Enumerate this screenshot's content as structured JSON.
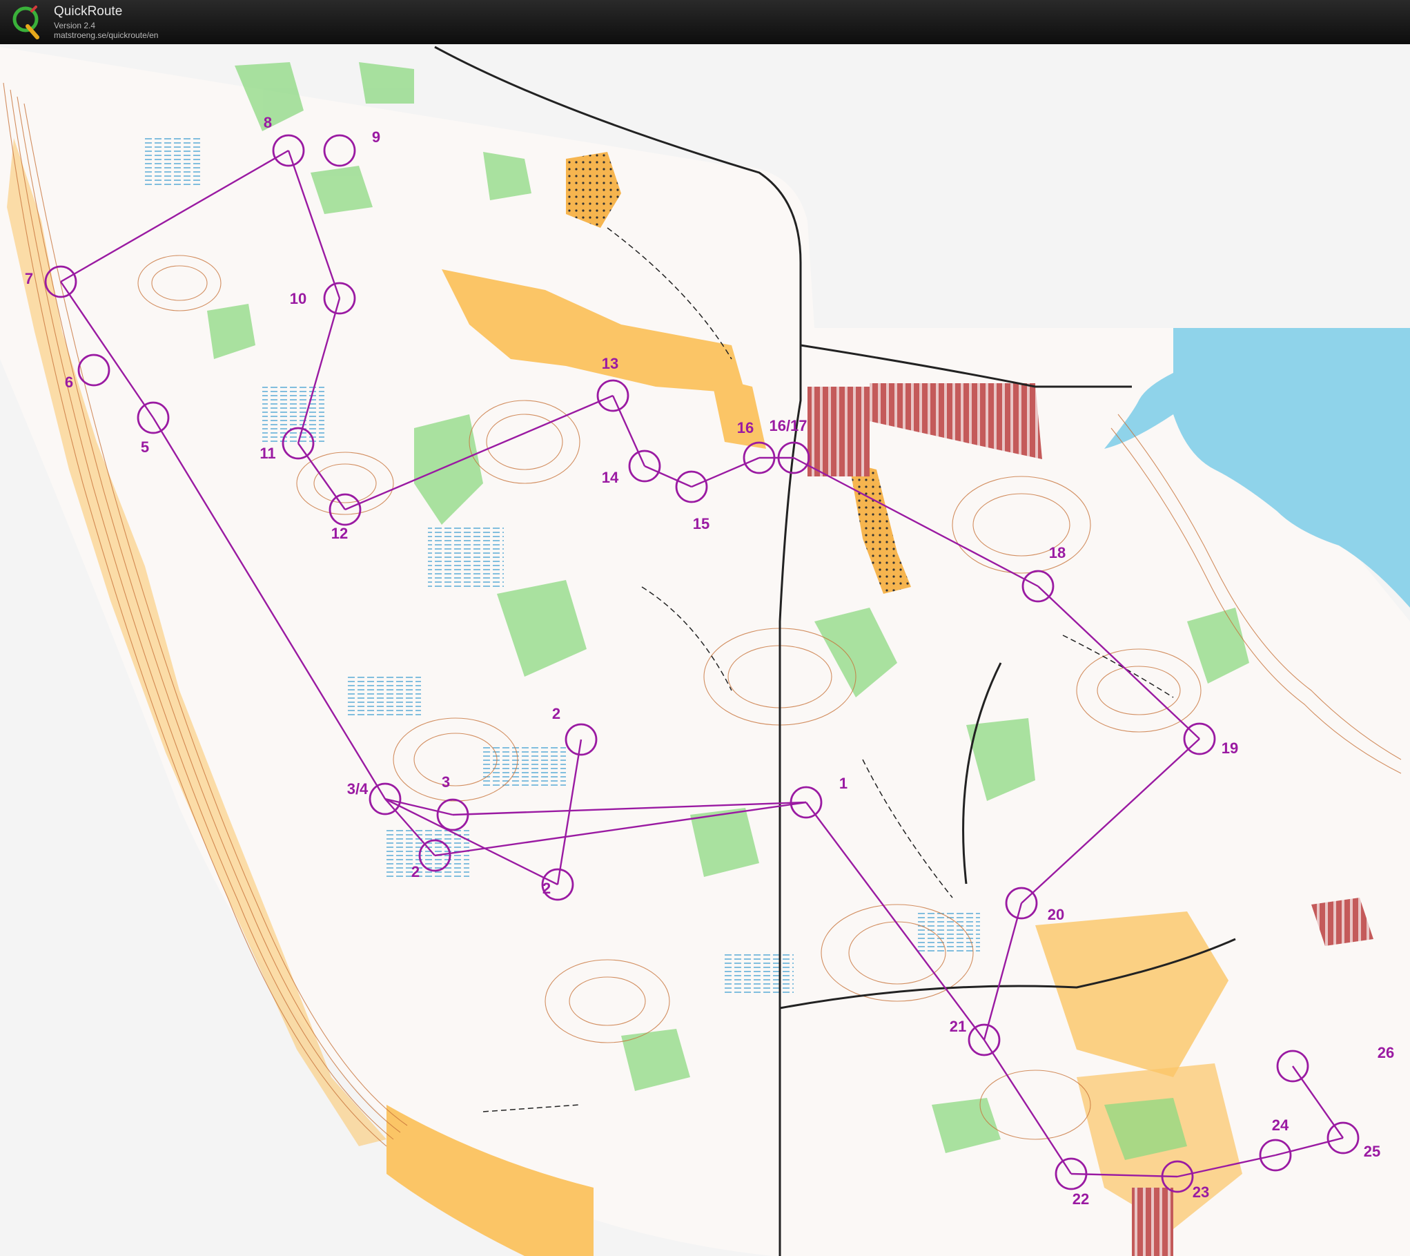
{
  "app": {
    "title": "QuickRoute",
    "version": "Version 2.4",
    "url": "matstroeng.se/quickroute/en",
    "logo_letter": "Q"
  },
  "colors": {
    "course": "#9a1aa2",
    "water": "#8fd3ea",
    "open_land": "#fbc566",
    "forest_green": "#8dd982",
    "map_paper": "#fbf8f6",
    "contour": "#c8743b",
    "settlement": "#b0303a"
  },
  "controls": [
    {
      "label": "1"
    },
    {
      "label": "2"
    },
    {
      "label": "3"
    },
    {
      "label": "3/4"
    },
    {
      "label": "2"
    },
    {
      "label": "2"
    },
    {
      "label": "5"
    },
    {
      "label": "6"
    },
    {
      "label": "7"
    },
    {
      "label": "8"
    },
    {
      "label": "9"
    },
    {
      "label": "10"
    },
    {
      "label": "11"
    },
    {
      "label": "12"
    },
    {
      "label": "13"
    },
    {
      "label": "14"
    },
    {
      "label": "15"
    },
    {
      "label": "16"
    },
    {
      "label": "16/17"
    },
    {
      "label": "18"
    },
    {
      "label": "19"
    },
    {
      "label": "20"
    },
    {
      "label": "21"
    },
    {
      "label": "22"
    },
    {
      "label": "23"
    },
    {
      "label": "24"
    },
    {
      "label": "25"
    },
    {
      "label": "26"
    }
  ]
}
